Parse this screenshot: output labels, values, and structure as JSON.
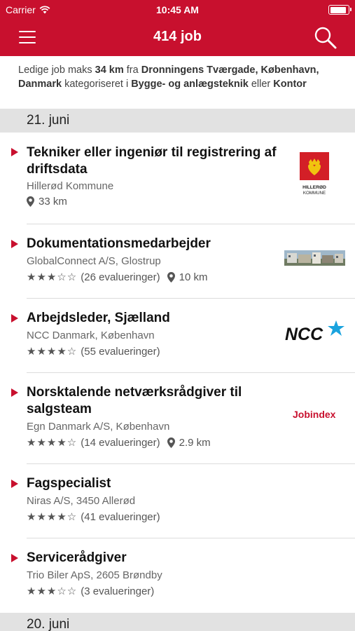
{
  "status_bar": {
    "carrier": "Carrier",
    "time": "10:45 AM",
    "battery_level": 0.95
  },
  "nav": {
    "title": "414 job"
  },
  "filter": {
    "t1": "Ledige job maks ",
    "distance": "34 km",
    "t2": " fra ",
    "location": "Dronningens Tværgade, København, Danmark",
    "t3": " kategoriseret i ",
    "category": "Bygge- og anlægsteknik",
    "t4": " eller ",
    "category2": "Kontor"
  },
  "sections": [
    {
      "date": "21. juni"
    },
    {
      "date": "20. juni"
    }
  ],
  "jobs": [
    {
      "title": "Tekniker eller ingeniør til registrering af driftsdata",
      "company": "Hillerød Kommune",
      "distance": "33 km",
      "logo": "HILLERØD KOMMUNE",
      "logo_line1": "HILLERØD",
      "logo_line2": "KOMMUNE"
    },
    {
      "title": "Dokumentationsmedarbejder",
      "company": "GlobalConnect A/S, Glostrup",
      "rating": 3,
      "stars": "★★★☆☆",
      "reviews": "(26 evalueringer)",
      "distance": "10 km",
      "logo": "building-photo"
    },
    {
      "title": "Arbejdsleder, Sjælland",
      "company": "NCC Danmark, København",
      "rating": 4,
      "stars": "★★★★☆",
      "reviews": "(55 evalueringer)",
      "logo": "NCC"
    },
    {
      "title": "Norsktalende netværksrådgiver til salgsteam",
      "company": "Egn Danmark A/S, København",
      "rating": 4,
      "stars": "★★★★☆",
      "reviews": "(14 evalueringer)",
      "distance": "2.9 km",
      "logo": "Jobindex"
    },
    {
      "title": "Fagspecialist",
      "company": "Niras A/S, 3450 Allerød",
      "rating": 4,
      "stars": "★★★★☆",
      "reviews": "(41 evalueringer)"
    },
    {
      "title": "Servicerådgiver",
      "company": "Trio Biler ApS, 2605 Brøndby",
      "rating": 3,
      "stars": "★★★☆☆",
      "reviews": "(3 evalueringer)"
    }
  ],
  "colors": {
    "brand": "#c8102e",
    "section_bg": "#e2e2e2",
    "ncc_star": "#1aa3de"
  },
  "icons": {
    "menu": "hamburger-icon",
    "search": "search-icon",
    "location": "location-pin-icon",
    "wifi": "wifi-icon",
    "battery": "battery-icon"
  }
}
